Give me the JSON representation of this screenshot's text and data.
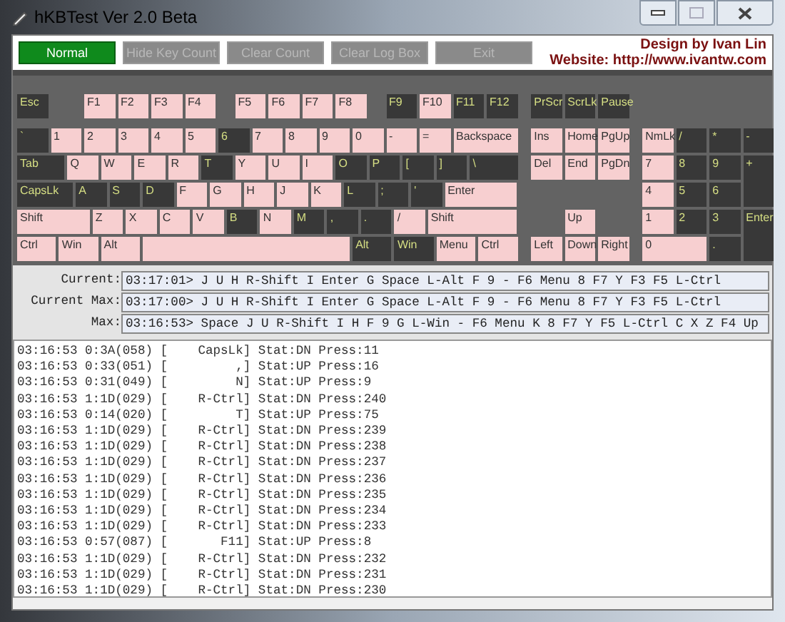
{
  "window": {
    "title": "hKBTest Ver 2.0 Beta"
  },
  "toolbar": {
    "buttons": [
      {
        "label": "Normal",
        "disabled": false
      },
      {
        "label": "Hide Key Count",
        "disabled": true
      },
      {
        "label": "Clear Count",
        "disabled": true
      },
      {
        "label": "Clear Log Box",
        "disabled": true
      },
      {
        "label": "Exit",
        "disabled": true
      }
    ],
    "credit": "Design by Ivan Lin",
    "website": "Website: http://www.ivantw.com"
  },
  "keyboard": {
    "function_row": [
      [
        {
          "label": "Esc",
          "pressed": false
        }
      ],
      [
        {
          "label": "F1",
          "pressed": true
        },
        {
          "label": "F2",
          "pressed": true
        },
        {
          "label": "F3",
          "pressed": true
        },
        {
          "label": "F4",
          "pressed": true
        }
      ],
      [
        {
          "label": "F5",
          "pressed": true
        },
        {
          "label": "F6",
          "pressed": true
        },
        {
          "label": "F7",
          "pressed": true
        },
        {
          "label": "F8",
          "pressed": true
        }
      ],
      [
        {
          "label": "F9",
          "pressed": false
        },
        {
          "label": "F10",
          "pressed": true
        },
        {
          "label": "F11",
          "pressed": false
        },
        {
          "label": "F12",
          "pressed": false
        }
      ]
    ],
    "main_rows": [
      [
        {
          "label": "`",
          "pressed": false
        },
        {
          "label": "1",
          "pressed": true
        },
        {
          "label": "2",
          "pressed": true
        },
        {
          "label": "3",
          "pressed": true
        },
        {
          "label": "4",
          "pressed": true
        },
        {
          "label": "5",
          "pressed": true
        },
        {
          "label": "6",
          "pressed": false
        },
        {
          "label": "7",
          "pressed": true
        },
        {
          "label": "8",
          "pressed": true
        },
        {
          "label": "9",
          "pressed": true
        },
        {
          "label": "0",
          "pressed": true
        },
        {
          "label": "-",
          "pressed": true
        },
        {
          "label": "=",
          "pressed": true
        },
        {
          "label": "Backspace",
          "pressed": true
        }
      ],
      [
        {
          "label": "Tab",
          "pressed": false
        },
        {
          "label": "Q",
          "pressed": true
        },
        {
          "label": "W",
          "pressed": true
        },
        {
          "label": "E",
          "pressed": true
        },
        {
          "label": "R",
          "pressed": true
        },
        {
          "label": "T",
          "pressed": false
        },
        {
          "label": "Y",
          "pressed": true
        },
        {
          "label": "U",
          "pressed": true
        },
        {
          "label": "I",
          "pressed": true
        },
        {
          "label": "O",
          "pressed": false
        },
        {
          "label": "P",
          "pressed": false
        },
        {
          "label": "[",
          "pressed": false
        },
        {
          "label": "]",
          "pressed": false
        },
        {
          "label": "\\",
          "pressed": false
        }
      ],
      [
        {
          "label": "CapsLk",
          "pressed": false
        },
        {
          "label": "A",
          "pressed": false
        },
        {
          "label": "S",
          "pressed": false
        },
        {
          "label": "D",
          "pressed": false
        },
        {
          "label": "F",
          "pressed": true
        },
        {
          "label": "G",
          "pressed": true
        },
        {
          "label": "H",
          "pressed": true
        },
        {
          "label": "J",
          "pressed": true
        },
        {
          "label": "K",
          "pressed": true
        },
        {
          "label": "L",
          "pressed": false
        },
        {
          "label": ";",
          "pressed": false
        },
        {
          "label": "'",
          "pressed": false
        },
        {
          "label": "Enter",
          "pressed": true
        }
      ],
      [
        {
          "label": "Shift",
          "pressed": true
        },
        {
          "label": "Z",
          "pressed": true
        },
        {
          "label": "X",
          "pressed": true
        },
        {
          "label": "C",
          "pressed": true
        },
        {
          "label": "V",
          "pressed": true
        },
        {
          "label": "B",
          "pressed": false
        },
        {
          "label": "N",
          "pressed": true
        },
        {
          "label": "M",
          "pressed": false
        },
        {
          "label": ",",
          "pressed": false
        },
        {
          "label": ".",
          "pressed": false
        },
        {
          "label": "/",
          "pressed": true
        },
        {
          "label": "Shift",
          "pressed": true
        }
      ],
      [
        {
          "label": "Ctrl",
          "pressed": true
        },
        {
          "label": "Win",
          "pressed": true
        },
        {
          "label": "Alt",
          "pressed": true
        },
        {
          "pressed": true
        },
        {
          "label": "Alt",
          "pressed": false
        },
        {
          "label": "Win",
          "pressed": false
        },
        {
          "label": "Menu",
          "pressed": true
        },
        {
          "label": "Ctrl",
          "pressed": true
        }
      ]
    ],
    "nav_top": [
      {
        "label": "PrScr",
        "pressed": false
      },
      {
        "label": "ScrLk",
        "pressed": false
      },
      {
        "label": "Pause",
        "pressed": false
      }
    ],
    "nav": [
      {
        "label": "Ins",
        "pressed": true
      },
      {
        "label": "Home",
        "pressed": true
      },
      {
        "label": "PgUp",
        "pressed": true
      },
      {
        "label": "Del",
        "pressed": true
      },
      {
        "label": "End",
        "pressed": true
      },
      {
        "label": "PgDn",
        "pressed": true
      },
      {
        "label": "Up",
        "pressed": true
      },
      {
        "label": "Left",
        "pressed": true
      },
      {
        "label": "Down",
        "pressed": true
      },
      {
        "label": "Right",
        "pressed": true
      }
    ],
    "numpad": [
      {
        "label": "NmLk",
        "pressed": true
      },
      {
        "label": "/",
        "pressed": false
      },
      {
        "label": "*",
        "pressed": false
      },
      {
        "label": "-",
        "pressed": false
      },
      {
        "label": "7",
        "pressed": true
      },
      {
        "label": "8",
        "pressed": false
      },
      {
        "label": "9",
        "pressed": false
      },
      {
        "label": "+",
        "pressed": false
      },
      {
        "label": "4",
        "pressed": true
      },
      {
        "label": "5",
        "pressed": false
      },
      {
        "label": "6",
        "pressed": false
      },
      {
        "label": "1",
        "pressed": true
      },
      {
        "label": "2",
        "pressed": false
      },
      {
        "label": "3",
        "pressed": false
      },
      {
        "label": "Enter",
        "pressed": false
      },
      {
        "label": "0",
        "pressed": true
      },
      {
        "label": ".",
        "pressed": false
      }
    ]
  },
  "status": [
    {
      "label": "Current:",
      "value": "03:17:01> J U H R-Shift I Enter G Space L-Alt F 9 - F6 Menu 8 F7 Y F3 F5 L-Ctrl"
    },
    {
      "label": "Current Max:",
      "value": "03:17:00> J U H R-Shift I Enter G Space L-Alt F 9 - F6 Menu 8 F7 Y F3 F5 L-Ctrl"
    },
    {
      "label": "Max:",
      "value": "03:16:53> Space J U R-Shift I H F 9 G L-Win - F6 Menu K 8 F7 Y F5 L-Ctrl C X Z F4 Up"
    }
  ],
  "log": [
    "03:16:53 0:3A(058) [    CapsLk] Stat:DN Press:11",
    "03:16:53 0:33(051) [         ,] Stat:UP Press:16",
    "03:16:53 0:31(049) [         N] Stat:UP Press:9",
    "03:16:53 1:1D(029) [    R-Ctrl] Stat:DN Press:240",
    "03:16:53 0:14(020) [         T] Stat:UP Press:75",
    "03:16:53 1:1D(029) [    R-Ctrl] Stat:DN Press:239",
    "03:16:53 1:1D(029) [    R-Ctrl] Stat:DN Press:238",
    "03:16:53 1:1D(029) [    R-Ctrl] Stat:DN Press:237",
    "03:16:53 1:1D(029) [    R-Ctrl] Stat:DN Press:236",
    "03:16:53 1:1D(029) [    R-Ctrl] Stat:DN Press:235",
    "03:16:53 1:1D(029) [    R-Ctrl] Stat:DN Press:234",
    "03:16:53 1:1D(029) [    R-Ctrl] Stat:DN Press:233",
    "03:16:53 0:57(087) [       F11] Stat:UP Press:8",
    "03:16:53 1:1D(029) [    R-Ctrl] Stat:DN Press:232",
    "03:16:53 1:1D(029) [    R-Ctrl] Stat:DN Press:231",
    "03:16:53 1:1D(029) [    R-Ctrl] Stat:DN Press:230"
  ]
}
